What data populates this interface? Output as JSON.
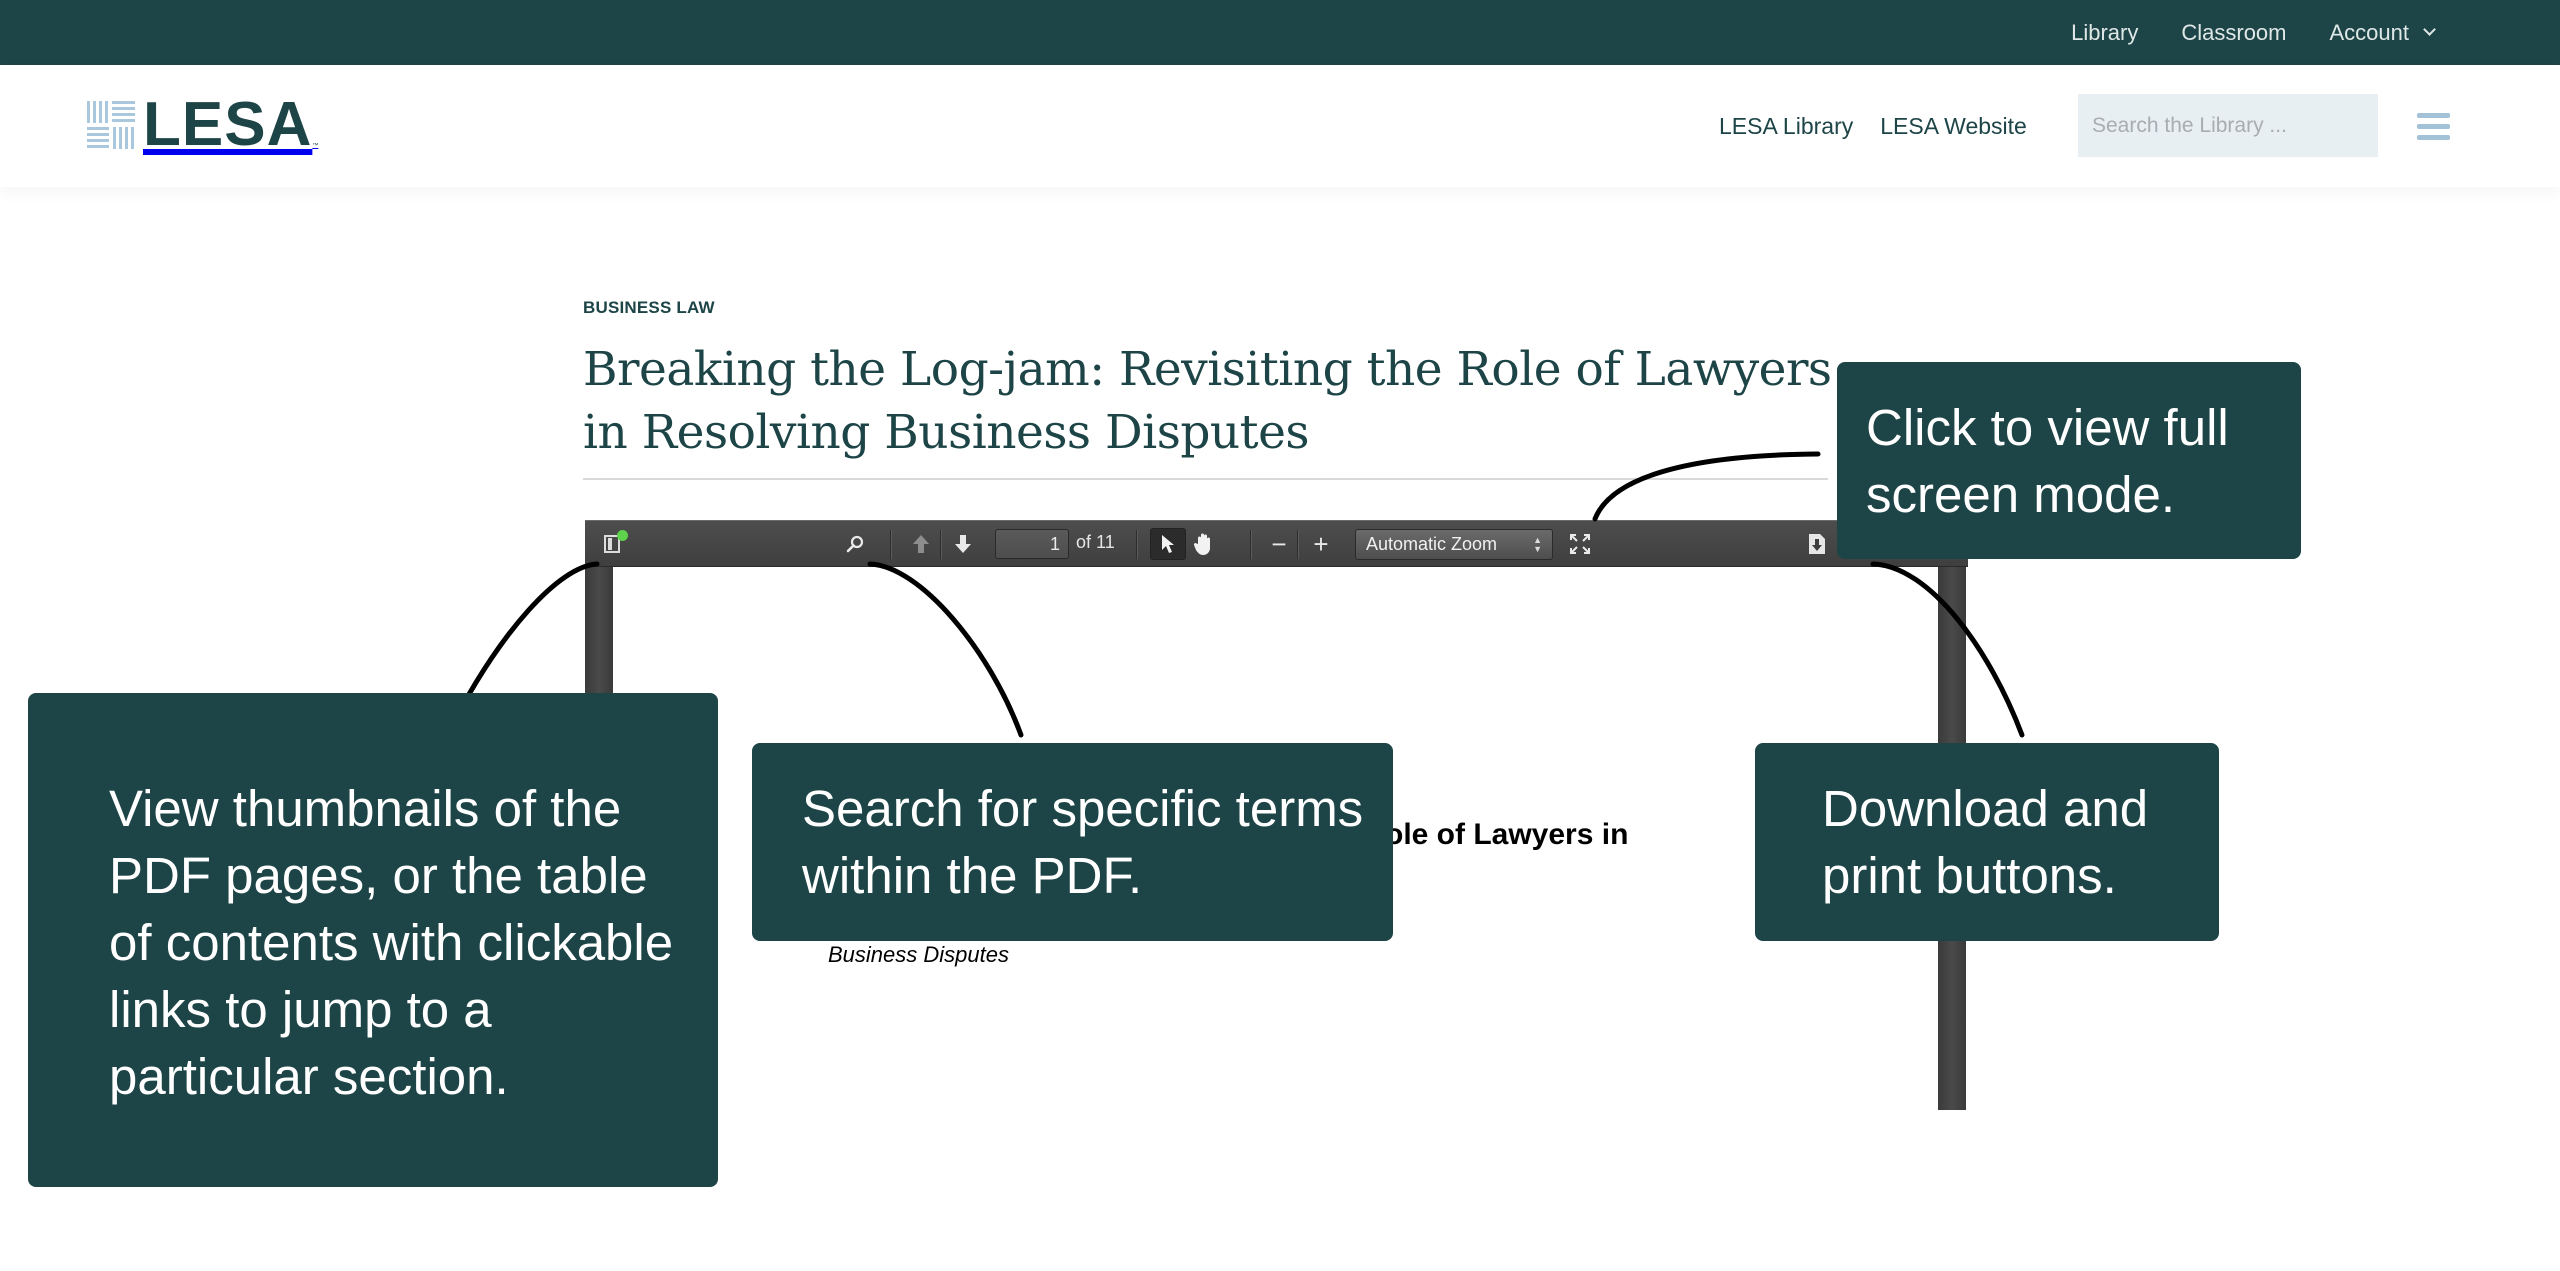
{
  "topbar": {
    "links": [
      "Library",
      "Classroom",
      "Account"
    ]
  },
  "header": {
    "logo_text": "LESA",
    "logo_tm": "™",
    "links": [
      "LESA Library",
      "LESA Website"
    ],
    "search_placeholder": "Search the Library ...",
    "search_value": ""
  },
  "article": {
    "category": "BUSINESS LAW",
    "title": "Breaking the Log-jam: Revisiting the Role of Lawyers in Resolving Business Disputes"
  },
  "pdf_viewer": {
    "current_page": "1",
    "page_count_label": "of 11",
    "zoom_label": "Automatic Zoom",
    "page_heading_visible": "ole of Lawyers in",
    "page_subtitle_visible": "Business Disputes"
  },
  "callouts": {
    "fullscreen": "Click to view full screen mode.",
    "thumbnails": "View thumbnails of the PDF pages, or the table of contents with clickable links to jump to a particular section.",
    "search": "Search for specific terms within the PDF.",
    "download": "Download and print buttons."
  },
  "colors": {
    "brand_dark_teal": "#1d4446",
    "logo_light_blue": "#a9c8dd",
    "search_bg": "#e7eff3",
    "toolbar_gray": "#464646",
    "notification_green": "#5ed24b"
  }
}
